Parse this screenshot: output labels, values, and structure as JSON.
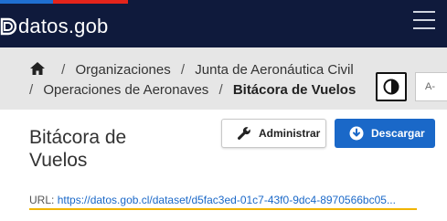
{
  "header": {
    "logo_text": "datos.gob",
    "colors": {
      "background": "#0f1a3c",
      "stripe_blue": "#1f6fd1",
      "stripe_red": "#e3241b"
    }
  },
  "breadcrumb": {
    "items": [
      "Organizaciones",
      "Junta de Aeronáutica Civil",
      "Operaciones de Aeronaves"
    ],
    "current": "Bitácora de Vuelos",
    "separator": "/"
  },
  "accessibility": {
    "font_size_label": "A-"
  },
  "dataset": {
    "title_line1": "Bitácora de",
    "title_line2": "Vuelos",
    "url_label": "URL:",
    "url_value": "https://datos.gob.cl/dataset/d5fac3ed-01c7-43f0-9dc4-8970566bc05..."
  },
  "actions": {
    "admin_label": "Administrar",
    "download_label": "Descargar",
    "download_color": "#1a68c8"
  }
}
